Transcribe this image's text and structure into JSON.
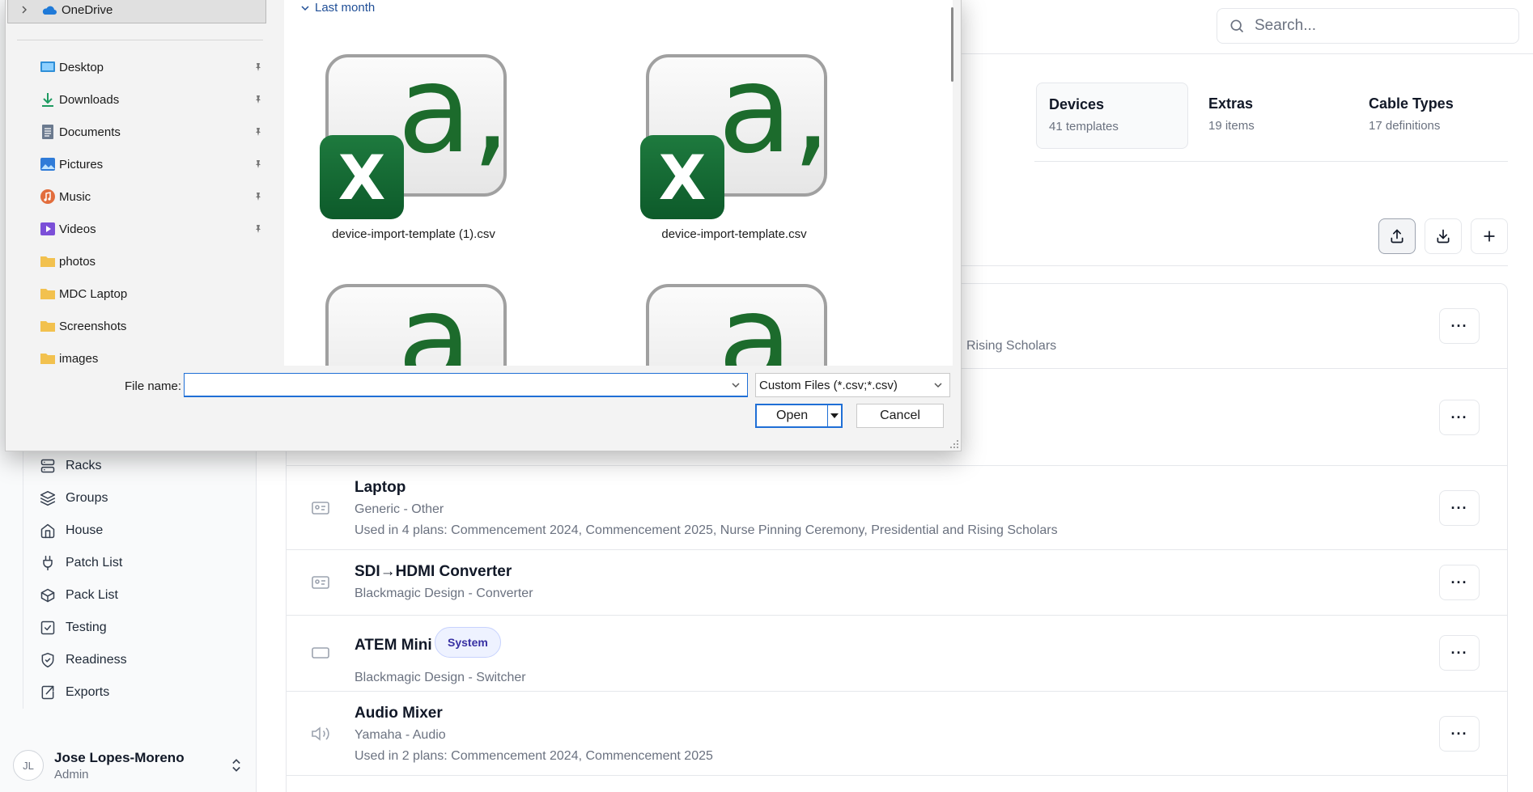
{
  "sidebar": {
    "nav": [
      {
        "label": "Racks",
        "icon": "server-icon"
      },
      {
        "label": "Groups",
        "icon": "layers-icon"
      },
      {
        "label": "House",
        "icon": "house-icon"
      },
      {
        "label": "Patch List",
        "icon": "plug-icon"
      },
      {
        "label": "Pack List",
        "icon": "package-icon"
      },
      {
        "label": "Testing",
        "icon": "checkbox-icon"
      },
      {
        "label": "Readiness",
        "icon": "shield-check-icon"
      },
      {
        "label": "Exports",
        "icon": "export-icon"
      }
    ],
    "user": {
      "initials": "JL",
      "name": "Jose Lopes-Moreno",
      "role": "Admin"
    }
  },
  "header": {
    "search_placeholder": "Search..."
  },
  "stats": [
    {
      "title": "Devices",
      "sub": "41 templates"
    },
    {
      "title": "Extras",
      "sub": "19 items"
    },
    {
      "title": "Cable Types",
      "sub": "17 definitions"
    }
  ],
  "rows": [
    {
      "title": "",
      "sub1": "",
      "sub2": "Rising Scholars",
      "icon": "device-icon"
    },
    {
      "title": "",
      "sub1": "",
      "sub2": "",
      "icon": "device-icon"
    },
    {
      "title": "Laptop",
      "sub1": "Generic - Other",
      "sub2": "Used in 4 plans: Commencement 2024, Commencement 2025, Nurse Pinning Ceremony, Presidential and Rising Scholars",
      "icon": "id-card-icon"
    },
    {
      "title": "SDI→HDMI Converter",
      "sub1": "Blackmagic Design - Converter",
      "icon": "id-card-icon"
    },
    {
      "title": "ATEM Mini",
      "badge": "System",
      "sub1": "Blackmagic Design - Switcher",
      "icon": "keyboard-icon"
    },
    {
      "title": "Audio Mixer",
      "sub1": "Yamaha - Audio",
      "sub2": "Used in 2 plans: Commencement 2024, Commencement 2025",
      "icon": "speaker-icon"
    }
  ],
  "dialog": {
    "nav": {
      "onedrive": "OneDrive",
      "quick_access": [
        {
          "label": "Desktop",
          "pinned": true,
          "icon": "desktop-icon",
          "color": "#2f8fd8"
        },
        {
          "label": "Downloads",
          "pinned": true,
          "icon": "download-icon",
          "color": "#1e9b61"
        },
        {
          "label": "Documents",
          "pinned": true,
          "icon": "document-icon",
          "color": "#6b7a8f"
        },
        {
          "label": "Pictures",
          "pinned": true,
          "icon": "pictures-icon",
          "color": "#2f7bd8"
        },
        {
          "label": "Music",
          "pinned": true,
          "icon": "music-icon",
          "color": "#e26d3c"
        },
        {
          "label": "Videos",
          "pinned": true,
          "icon": "videos-icon",
          "color": "#7b4fd8"
        },
        {
          "label": "photos",
          "pinned": false,
          "icon": "folder-icon",
          "color": "#f2c14e"
        },
        {
          "label": "MDC Laptop",
          "pinned": false,
          "icon": "folder-icon",
          "color": "#f2c14e"
        },
        {
          "label": "Screenshots",
          "pinned": false,
          "icon": "folder-icon",
          "color": "#f2c14e"
        },
        {
          "label": "images",
          "pinned": false,
          "icon": "folder-icon",
          "color": "#f2c14e"
        }
      ]
    },
    "group_header": "Last month",
    "files": [
      {
        "name": "device-import-template (1).csv"
      },
      {
        "name": "device-import-template.csv"
      },
      {
        "name": ""
      },
      {
        "name": ""
      }
    ],
    "file_name_label": "File name:",
    "file_name_value": "",
    "file_type": "Custom Files (*.csv;*.csv)",
    "open_label": "Open",
    "cancel_label": "Cancel"
  }
}
